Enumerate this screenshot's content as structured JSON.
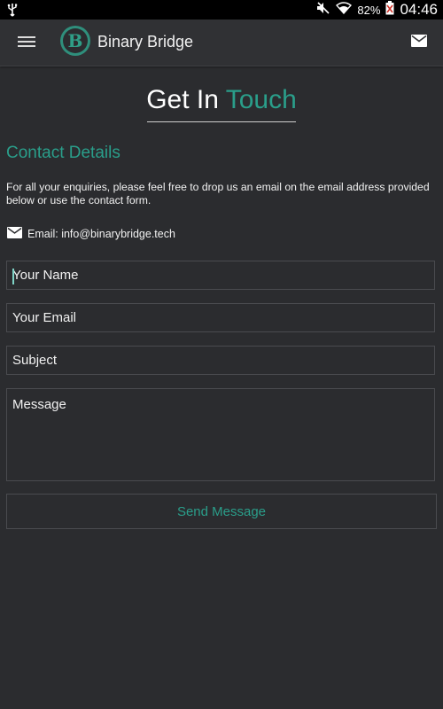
{
  "status_bar": {
    "battery": "82%",
    "time": "04:46",
    "icons": [
      "usb-icon",
      "mute-icon",
      "wifi-icon",
      "battery-icon"
    ]
  },
  "app_bar": {
    "title": "Binary Bridge",
    "logo_letter": "B",
    "icons": [
      "menu-icon",
      "mail-icon"
    ]
  },
  "heading": {
    "part1": "Get In",
    "part2": "Touch"
  },
  "contact": {
    "title": "Contact Details",
    "intro": "For all your enquiries, please feel free to drop us an email on the email address provided below or use the contact form.",
    "email_text": "Email: info@binarybridge.tech"
  },
  "form": {
    "name_placeholder": "Your Name",
    "email_placeholder": "Your Email",
    "subject_placeholder": "Subject",
    "message_placeholder": "Message",
    "send_label": "Send Message"
  },
  "colors": {
    "accent": "#2a9e8a",
    "background": "#2b2c2f",
    "appbar": "#303134"
  }
}
